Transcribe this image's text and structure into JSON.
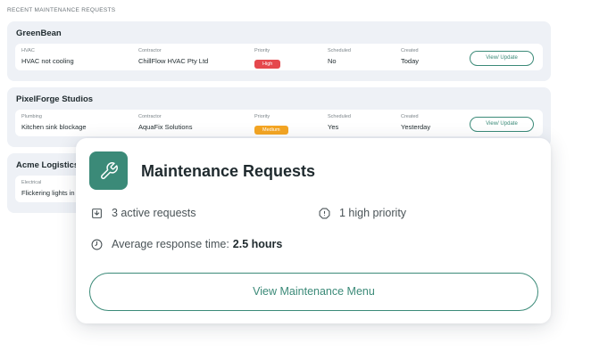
{
  "section_title": "RECENT MAINTENANCE REQUESTS",
  "view_update_label": "View/ Update",
  "column_labels": {
    "contractor": "Contractor",
    "priority": "Priority",
    "scheduled": "Scheduled",
    "created": "Created"
  },
  "groups": [
    {
      "name": "GreenBean",
      "category": "HVAC",
      "issue": "HVAC not cooling",
      "contractor": "ChillFlow HVAC Pty Ltd",
      "priority": "High",
      "priority_color": "#e5484d",
      "scheduled": "No",
      "created": "Today"
    },
    {
      "name": "PixelForge Studios",
      "category": "Plumbing",
      "issue": "Kitchen sink blockage",
      "contractor": "AquaFix Solutions",
      "priority": "Medium",
      "priority_color": "#f5a623",
      "scheduled": "Yes",
      "created": "Yesterday"
    },
    {
      "name": "Acme Logistics",
      "category": "Electrical",
      "issue": "Flickering lights in"
    }
  ],
  "card": {
    "title": "Maintenance Requests",
    "icon": "wrench-icon",
    "accent_color": "#3b8a78",
    "active_requests": "3 active requests",
    "high_priority": "1 high priority",
    "response_time_label": "Average response time:",
    "response_time_value": "2.5 hours",
    "button_label": "View Maintenance Menu"
  }
}
